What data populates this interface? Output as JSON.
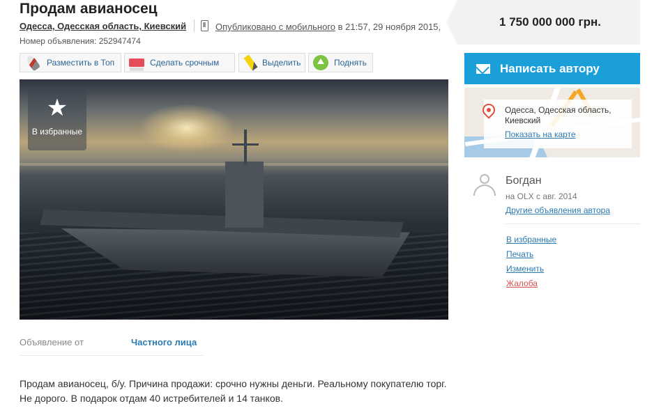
{
  "ad": {
    "title": "Продам авианосец",
    "location": "Одесса, Одесская область, Киевский",
    "published_link": "Опубликовано с мобильного",
    "published_time": " в 21:57, 29 ноября 2015,",
    "ad_number": "Номер объявления: 252947474"
  },
  "promo_buttons": [
    {
      "label": "Разместить в Топ",
      "icon": "rocket-icon"
    },
    {
      "label": "Сделать срочным",
      "icon": "urgent-tag-icon"
    },
    {
      "label": "Выделить",
      "icon": "highlighter-icon"
    },
    {
      "label": "Поднять",
      "icon": "lift-up-icon"
    }
  ],
  "photo": {
    "favorite_label": "В избранные",
    "favorite_icon": "star-icon",
    "alt": "aircraft-carrier-photo"
  },
  "details": {
    "label": "Объявление от",
    "value": "Частного лица"
  },
  "description": "Продам авианосец, б/у. Причина продажи: срочно нужны деньги. Реальному покупателю торг. Не дорого. В подарок отдам 40 истребителей и 14 танков.",
  "sidebar": {
    "price": "1 750 000 000 грн.",
    "write_button": "Написать автору",
    "map": {
      "address": "Одесса, Одесская область, Киевский",
      "show_on_map": "Показать на карте"
    },
    "user": {
      "name": "Богдан",
      "since": "на OLX с авг. 2014",
      "other_ads": "Другие объявления автора"
    },
    "actions": [
      "В избранные",
      "Печать",
      "Изменить",
      "Жалоба"
    ]
  },
  "colors": {
    "accent": "#1a9fd8",
    "link": "#2a7ab0",
    "complaint": "#d9534f"
  }
}
